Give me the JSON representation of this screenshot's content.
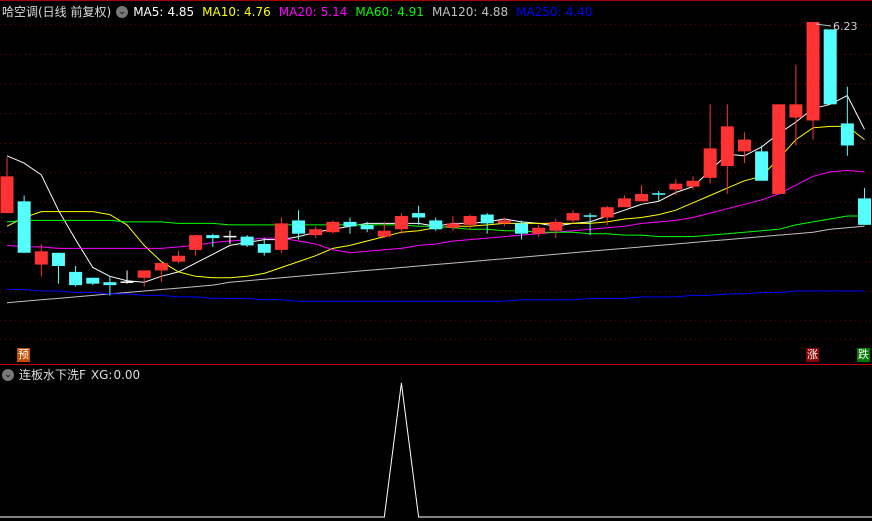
{
  "header": {
    "title": "哈空调(日线 前复权)",
    "ma": [
      {
        "label": "MA5:",
        "value": "4.85",
        "color": "#ffffff"
      },
      {
        "label": "MA10:",
        "value": "4.76",
        "color": "#ffff00"
      },
      {
        "label": "MA20:",
        "value": "5.14",
        "color": "#ff00ff"
      },
      {
        "label": "MA60:",
        "value": "4.91",
        "color": "#00ff00"
      },
      {
        "label": "MA120:",
        "value": "4.88",
        "color": "#c0c0c0"
      },
      {
        "label": "MA250:",
        "value": "4.40",
        "color": "#0000ff"
      }
    ]
  },
  "indicator": {
    "name": "连板水下洗F",
    "xg_label": "XG:",
    "xg_value": "0.00"
  },
  "tags": {
    "forecast": "预",
    "up": "涨",
    "down": "跌"
  },
  "chart_data": {
    "type": "candlestick",
    "max_label": "6.23",
    "colors": {
      "up": "#ff3333",
      "down": "#54ffff"
    },
    "candles": [
      [
        4.93,
        5.18,
        5.31,
        4.93
      ],
      [
        5.01,
        4.66,
        5.05,
        4.66
      ],
      [
        4.58,
        4.67,
        4.72,
        4.5
      ],
      [
        4.66,
        4.57,
        4.66,
        4.45
      ],
      [
        4.53,
        4.44,
        4.57,
        4.43
      ],
      [
        4.49,
        4.45,
        4.49,
        4.44
      ],
      [
        4.46,
        4.44,
        4.5,
        4.37
      ],
      [
        4.46,
        4.46,
        4.54,
        4.45
      ],
      [
        4.49,
        4.54,
        4.54,
        4.43
      ],
      [
        4.54,
        4.59,
        4.59,
        4.46
      ],
      [
        4.6,
        4.64,
        4.67,
        4.59
      ],
      [
        4.68,
        4.78,
        4.78,
        4.64
      ],
      [
        4.78,
        4.76,
        4.79,
        4.7
      ],
      [
        4.77,
        4.77,
        4.81,
        4.72
      ],
      [
        4.77,
        4.71,
        4.78,
        4.7
      ],
      [
        4.72,
        4.66,
        4.76,
        4.64
      ],
      [
        4.68,
        4.86,
        4.9,
        4.66
      ],
      [
        4.88,
        4.79,
        4.95,
        4.75
      ],
      [
        4.78,
        4.82,
        4.84,
        4.76
      ],
      [
        4.8,
        4.87,
        4.88,
        4.79
      ],
      [
        4.87,
        4.84,
        4.9,
        4.79
      ],
      [
        4.85,
        4.82,
        4.87,
        4.8
      ],
      [
        4.77,
        4.81,
        4.87,
        4.76
      ],
      [
        4.82,
        4.91,
        4.93,
        4.79
      ],
      [
        4.93,
        4.9,
        4.98,
        4.85
      ],
      [
        4.88,
        4.82,
        4.9,
        4.81
      ],
      [
        4.83,
        4.86,
        4.91,
        4.81
      ],
      [
        4.85,
        4.91,
        4.92,
        4.82
      ],
      [
        4.92,
        4.86,
        4.93,
        4.79
      ],
      [
        4.86,
        4.88,
        4.9,
        4.84
      ],
      [
        4.86,
        4.79,
        4.88,
        4.75
      ],
      [
        4.79,
        4.83,
        4.85,
        4.77
      ],
      [
        4.81,
        4.87,
        4.89,
        4.76
      ],
      [
        4.88,
        4.93,
        4.95,
        4.86
      ],
      [
        4.91,
        4.91,
        4.93,
        4.78
      ],
      [
        4.9,
        4.97,
        4.98,
        4.85
      ],
      [
        4.97,
        5.03,
        5.05,
        4.97
      ],
      [
        5.01,
        5.06,
        5.12,
        5.01
      ],
      [
        5.06,
        5.06,
        5.08,
        5.01
      ],
      [
        5.09,
        5.13,
        5.16,
        5.05
      ],
      [
        5.11,
        5.15,
        5.18,
        5.09
      ],
      [
        5.17,
        5.37,
        5.67,
        5.13
      ],
      [
        5.25,
        5.52,
        5.67,
        5.06
      ],
      [
        5.35,
        5.43,
        5.48,
        5.27
      ],
      [
        5.35,
        5.15,
        5.39,
        5.15
      ],
      [
        5.06,
        5.67,
        5.67,
        5.06
      ],
      [
        5.58,
        5.67,
        5.94,
        5.39
      ],
      [
        5.56,
        6.23,
        6.23,
        5.43
      ],
      [
        6.18,
        5.67,
        6.18,
        5.67
      ],
      [
        5.54,
        5.39,
        5.79,
        5.32
      ],
      [
        5.03,
        4.85,
        5.1,
        4.85
      ]
    ],
    "ma_series": [
      {
        "name": "MA5",
        "color": "#ffffff",
        "values": [
          5.32,
          5.27,
          5.19,
          4.95,
          4.75,
          4.56,
          4.5,
          4.47,
          4.46,
          4.5,
          4.53,
          4.59,
          4.65,
          4.71,
          4.73,
          4.75,
          4.75,
          4.77,
          4.8,
          4.82,
          4.84,
          4.86,
          4.86,
          4.86,
          4.86,
          4.84,
          4.86,
          4.86,
          4.87,
          4.89,
          4.87,
          4.86,
          4.84,
          4.86,
          4.87,
          4.91,
          4.95,
          4.99,
          5.01,
          5.07,
          5.11,
          5.22,
          5.33,
          5.32,
          5.38,
          5.47,
          5.55,
          5.64,
          5.67,
          5.73,
          5.5
        ]
      },
      {
        "name": "MA10",
        "color": "#ffff00",
        "values": [
          4.84,
          4.9,
          4.94,
          4.94,
          4.94,
          4.94,
          4.92,
          4.85,
          4.71,
          4.6,
          4.53,
          4.5,
          4.49,
          4.49,
          4.5,
          4.52,
          4.56,
          4.6,
          4.64,
          4.69,
          4.71,
          4.74,
          4.77,
          4.8,
          4.81,
          4.83,
          4.84,
          4.84,
          4.85,
          4.86,
          4.86,
          4.86,
          4.86,
          4.86,
          4.86,
          4.87,
          4.89,
          4.9,
          4.92,
          4.95,
          5.0,
          5.05,
          5.1,
          5.15,
          5.18,
          5.3,
          5.43,
          5.51,
          5.52,
          5.52,
          5.43
        ]
      },
      {
        "name": "MA20",
        "color": "#ff00ff",
        "values": [
          4.71,
          4.7,
          4.7,
          4.69,
          4.69,
          4.69,
          4.69,
          4.69,
          4.69,
          4.69,
          4.7,
          4.71,
          4.73,
          4.74,
          4.75,
          4.76,
          4.76,
          4.74,
          4.72,
          4.68,
          4.66,
          4.67,
          4.68,
          4.69,
          4.71,
          4.72,
          4.74,
          4.75,
          4.76,
          4.77,
          4.78,
          4.79,
          4.8,
          4.81,
          4.82,
          4.83,
          4.84,
          4.86,
          4.87,
          4.88,
          4.9,
          4.93,
          4.96,
          4.99,
          5.02,
          5.06,
          5.12,
          5.18,
          5.21,
          5.22,
          5.21
        ]
      },
      {
        "name": "MA60",
        "color": "#00ff00",
        "values": [
          4.87,
          4.88,
          4.88,
          4.88,
          4.88,
          4.88,
          4.88,
          4.87,
          4.87,
          4.87,
          4.86,
          4.86,
          4.86,
          4.85,
          4.85,
          4.85,
          4.85,
          4.85,
          4.85,
          4.85,
          4.85,
          4.85,
          4.85,
          4.85,
          4.84,
          4.84,
          4.83,
          4.82,
          4.82,
          4.81,
          4.81,
          4.8,
          4.8,
          4.8,
          4.79,
          4.79,
          4.78,
          4.78,
          4.77,
          4.77,
          4.77,
          4.78,
          4.79,
          4.8,
          4.81,
          4.82,
          4.85,
          4.87,
          4.89,
          4.91,
          4.91
        ]
      },
      {
        "name": "MA120",
        "color": "#c0c0c0",
        "values": [
          4.32,
          4.33,
          4.34,
          4.35,
          4.36,
          4.37,
          4.38,
          4.39,
          4.4,
          4.41,
          4.42,
          4.43,
          4.44,
          4.46,
          4.47,
          4.48,
          4.49,
          4.5,
          4.51,
          4.52,
          4.53,
          4.54,
          4.55,
          4.56,
          4.57,
          4.58,
          4.59,
          4.6,
          4.61,
          4.62,
          4.63,
          4.64,
          4.65,
          4.66,
          4.67,
          4.68,
          4.69,
          4.7,
          4.71,
          4.72,
          4.73,
          4.74,
          4.75,
          4.76,
          4.77,
          4.78,
          4.79,
          4.8,
          4.82,
          4.83,
          4.84
        ]
      },
      {
        "name": "MA250",
        "color": "#0000ff",
        "values": [
          4.41,
          4.41,
          4.4,
          4.4,
          4.39,
          4.39,
          4.38,
          4.38,
          4.37,
          4.37,
          4.36,
          4.36,
          4.35,
          4.35,
          4.35,
          4.34,
          4.34,
          4.33,
          4.33,
          4.33,
          4.33,
          4.33,
          4.33,
          4.33,
          4.33,
          4.33,
          4.33,
          4.33,
          4.33,
          4.33,
          4.34,
          4.34,
          4.34,
          4.34,
          4.35,
          4.35,
          4.35,
          4.36,
          4.36,
          4.36,
          4.37,
          4.37,
          4.38,
          4.38,
          4.39,
          4.39,
          4.4,
          4.4,
          4.4,
          4.4,
          4.4
        ]
      }
    ],
    "xg_values": [
      0,
      0,
      0,
      0,
      0,
      0,
      0,
      0,
      0,
      0,
      0,
      0,
      0,
      0,
      0,
      0,
      0,
      0,
      0,
      0,
      0,
      0,
      0,
      1,
      0,
      0,
      0,
      0,
      0,
      0,
      0,
      0,
      0,
      0,
      0,
      0,
      0,
      0,
      0,
      0,
      0,
      0,
      0,
      0,
      0,
      0,
      0,
      0,
      0,
      0,
      0
    ]
  }
}
